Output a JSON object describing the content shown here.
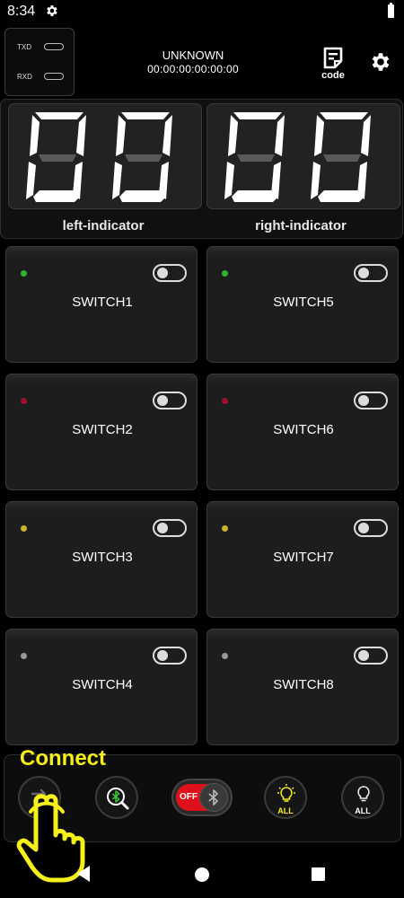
{
  "status_bar": {
    "time": "8:34",
    "icons": [
      "gear-icon",
      "battery-icon"
    ]
  },
  "serial": {
    "tx_label": "TXD",
    "rx_label": "RXD"
  },
  "connection": {
    "status": "UNKNOWN",
    "elapsed": "00:00:00:00:00:00"
  },
  "code_button": {
    "label": "code",
    "icon": "code-doc-icon"
  },
  "settings_button": {
    "icon": "gear-icon"
  },
  "indicators": [
    {
      "label": "left-indicator",
      "digits": "00"
    },
    {
      "label": "right-indicator",
      "digits": "00"
    }
  ],
  "switches": [
    {
      "label": "SWITCH1",
      "led_color": "#2fb52f"
    },
    {
      "label": "SWITCH5",
      "led_color": "#2fb52f"
    },
    {
      "label": "SWITCH2",
      "led_color": "#a0112f"
    },
    {
      "label": "SWITCH6",
      "led_color": "#a0112f"
    },
    {
      "label": "SWITCH3",
      "led_color": "#c8b424"
    },
    {
      "label": "SWITCH7",
      "led_color": "#c8b424"
    },
    {
      "label": "SWITCH4",
      "led_color": "#9a9a9a"
    },
    {
      "label": "SWITCH8",
      "led_color": "#9a9a9a"
    }
  ],
  "toolbar": {
    "connect_hint": "Connect",
    "bt_toggle": {
      "off_label": "OFF"
    },
    "all_on_label": "ALL",
    "all_off_label": "ALL"
  },
  "colors": {
    "accent_yellow": "#f5ef1a",
    "off_red": "#e0101a",
    "search_green": "#3ac23a"
  }
}
